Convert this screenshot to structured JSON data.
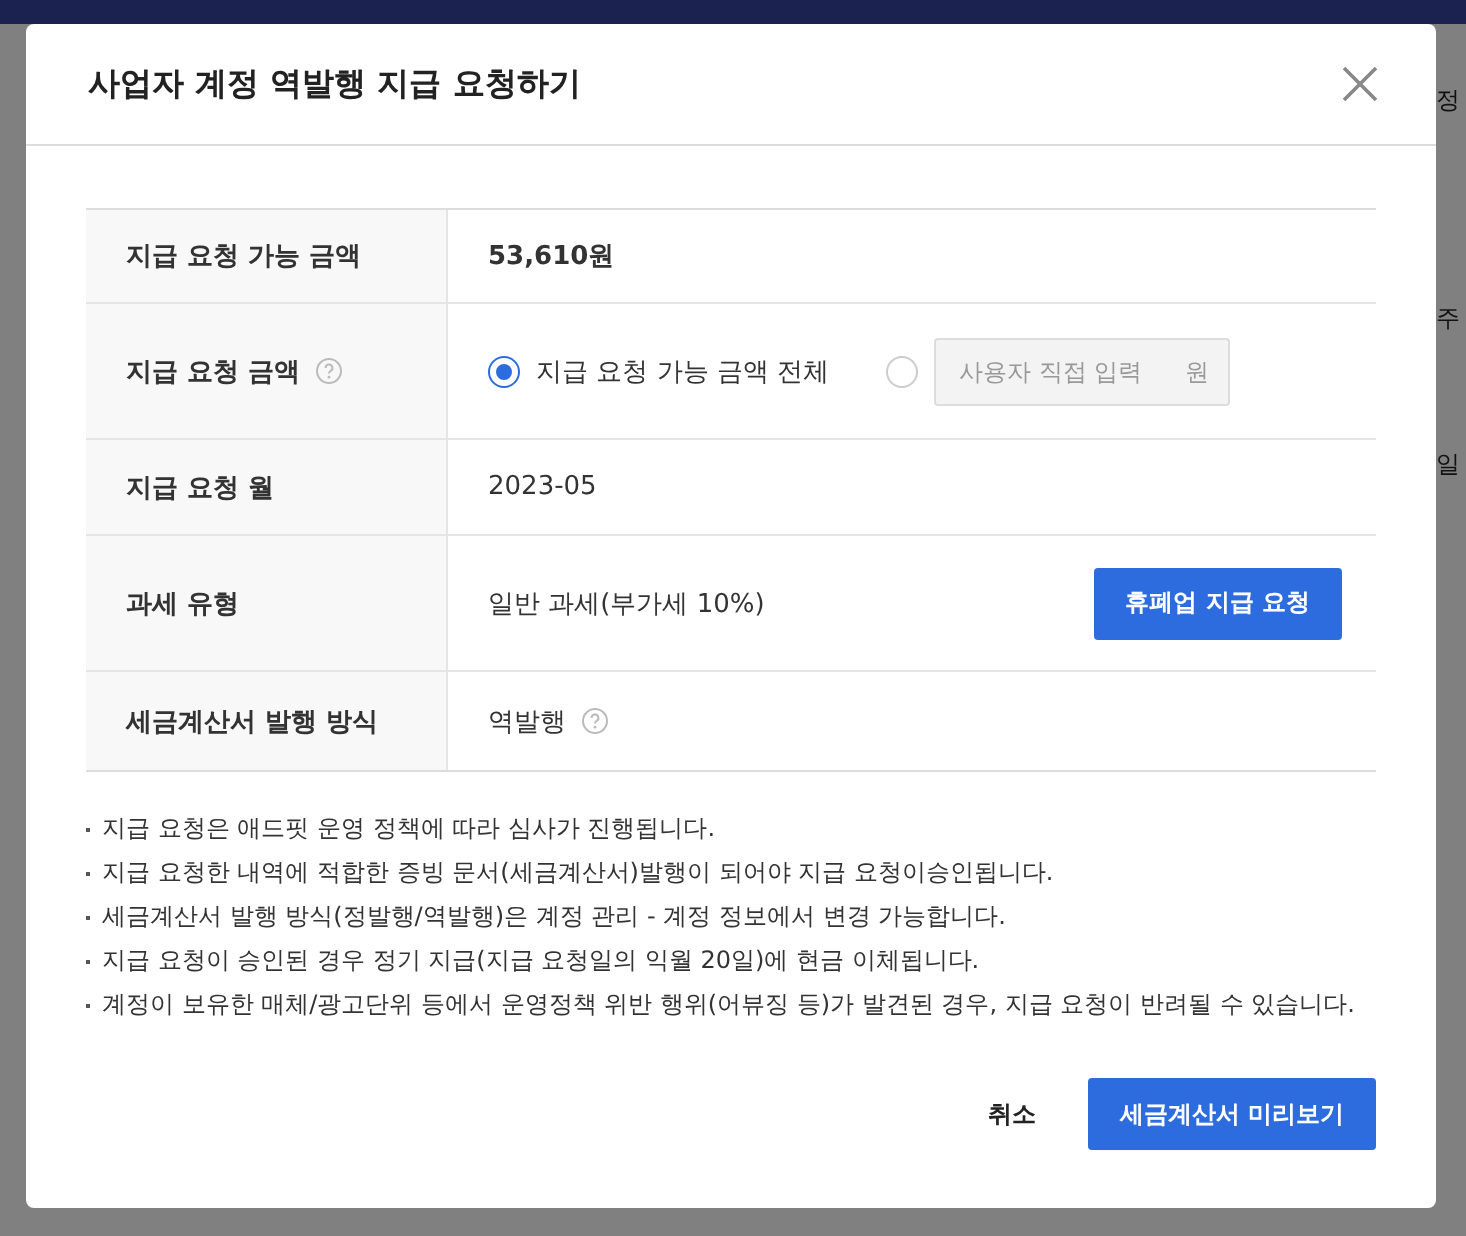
{
  "background": {
    "right_fragments": [
      "정",
      "주",
      "일"
    ]
  },
  "dialog": {
    "title": "사업자 계정 역발행 지급 요청하기",
    "rows": [
      {
        "kind": "text",
        "label": "지급 요청 가능 금액",
        "help": false,
        "value": "53,610원",
        "emphasis": true
      },
      {
        "kind": "radio",
        "label": "지급 요청 금액",
        "help": true,
        "options": [
          {
            "kind": "label",
            "label": "지급 요청 가능 금액 전체",
            "selected": true
          },
          {
            "kind": "input",
            "placeholder": "사용자 직접 입력",
            "unit": "원",
            "selected": false
          }
        ]
      },
      {
        "kind": "text",
        "label": "지급 요청 월",
        "help": false,
        "value": "2023-05",
        "emphasis": false
      },
      {
        "kind": "text",
        "label": "과세 유형",
        "help": false,
        "value": "일반 과세(부가세 10%)",
        "emphasis": false,
        "button": "휴폐업 지급 요청"
      },
      {
        "kind": "text",
        "label": "세금계산서 발행 방식",
        "help": false,
        "value": "역발행",
        "value_help": true,
        "emphasis": false
      }
    ],
    "notes": [
      "지급 요청은 애드핏 운영 정책에 따라 심사가 진행됩니다.",
      "지급 요청한 내역에 적합한 증빙 문서(세금계산서)발행이 되어야 지급 요청이승인됩니다.",
      "세금계산서 발행 방식(정발행/역발행)은 계정 관리 - 계정 정보에서 변경 가능합니다.",
      "지급 요청이 승인된 경우 정기 지급(지급 요청일의 익월 20일)에 현금 이체됩니다.",
      "계정이 보유한 매체/광고단위 등에서 운영정책 위반 행위(어뷰징 등)가 발견된 경우, 지급 요청이 반려될 수 있습니다."
    ],
    "cancel": "취소",
    "confirm": "세금계산서 미리보기"
  }
}
